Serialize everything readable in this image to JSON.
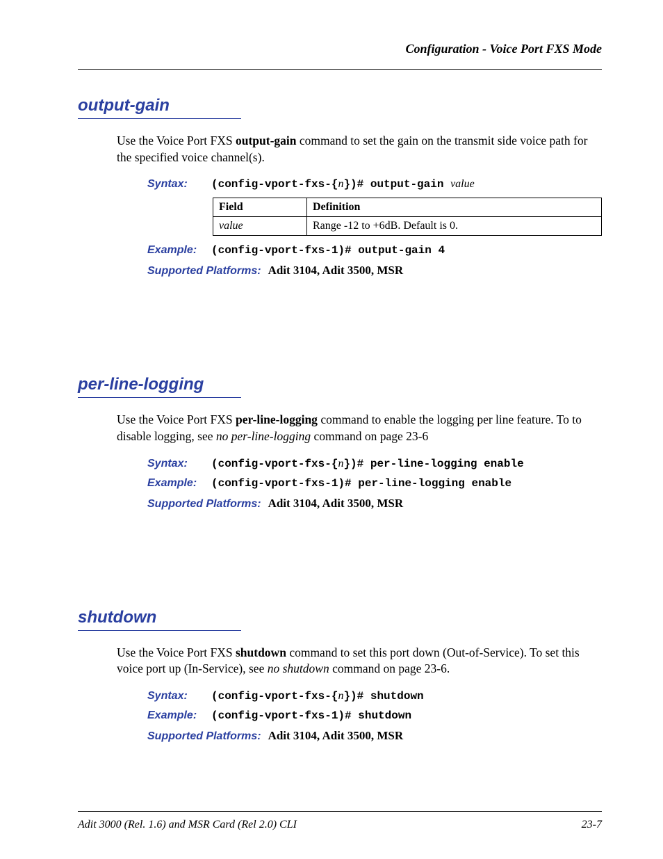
{
  "header": {
    "title": "Configuration - Voice Port FXS Mode"
  },
  "labels": {
    "syntax": "Syntax:",
    "example": "Example:",
    "supported_platforms": "Supported Platforms:",
    "field": "Field",
    "definition": "Definition"
  },
  "sections": {
    "output_gain": {
      "title": "output-gain",
      "desc_pre": "Use the Voice Port FXS ",
      "desc_bold": "output-gain",
      "desc_mid": " command to set the ",
      "desc_post": "gain on the transmit side voice path for the specified voice channel(s).",
      "syntax_pre": "(config-vport-fxs-{",
      "syntax_n": "n",
      "syntax_mid": "})# output-gain ",
      "syntax_var": "value",
      "table": {
        "field": "value",
        "definition": "Range -12 to +6dB. Default is 0."
      },
      "example": "(config-vport-fxs-1)# output-gain 4",
      "platforms": "Adit 3104, Adit 3500, MSR"
    },
    "per_line_logging": {
      "title": "per-line-logging",
      "desc_pre": "Use the Voice Port FXS ",
      "desc_bold": "per-line-logging",
      "desc_mid": " command to enable the logging per line feature. To to disable logging, see ",
      "desc_ital": "no per-line-logging",
      "desc_post": " command on page 23-6",
      "syntax_pre": "(config-vport-fxs-{",
      "syntax_n": "n",
      "syntax_post": "})# per-line-logging enable",
      "example": "(config-vport-fxs-1)# per-line-logging enable",
      "platforms": "Adit 3104, Adit 3500, MSR"
    },
    "shutdown": {
      "title": "shutdown",
      "desc_pre": "Use the Voice Port FXS ",
      "desc_bold": "shutdown",
      "desc_mid": " command to set this port down (Out-of-Service). To set this voice port up (In-Service), see ",
      "desc_ital": "no shutdown",
      "desc_post": " command on page 23-6.",
      "syntax_pre": "(config-vport-fxs-{",
      "syntax_n": "n",
      "syntax_post": "})# shutdown",
      "example": "(config-vport-fxs-1)# shutdown",
      "platforms": "Adit 3104, Adit 3500, MSR"
    }
  },
  "footer": {
    "left": "Adit 3000 (Rel. 1.6) and MSR Card (Rel 2.0) CLI",
    "right": "23-7"
  }
}
